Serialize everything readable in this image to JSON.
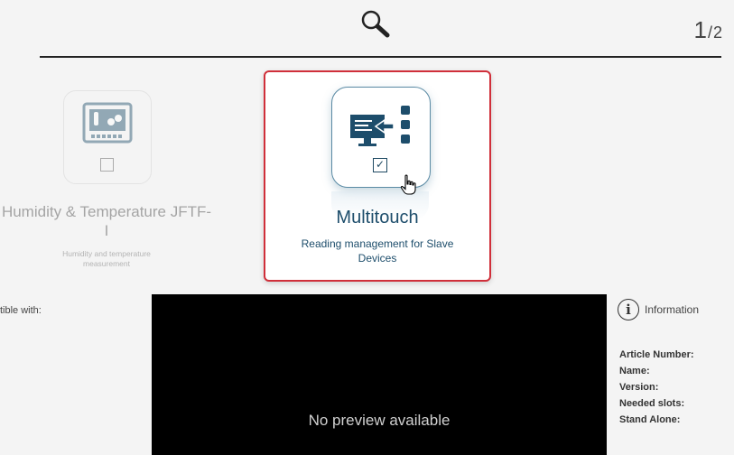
{
  "header": {
    "search_icon": "search-icon",
    "page_current": "1",
    "page_total": "2"
  },
  "cards": [
    {
      "title": "Humidity & Temperature JFTF-I",
      "description": "Humidity and temperature measurement",
      "icon": "humidity-temperature-icon",
      "checked": false
    },
    {
      "title": "Multitouch",
      "description": "Reading management for Slave Devices",
      "icon": "multitouch-icon",
      "checked": true,
      "highlight_color": "#d02f3a"
    }
  ],
  "compat_label": "tible with:",
  "preview": {
    "text": "No preview available"
  },
  "info": {
    "header": "Information",
    "rows": [
      "Article Number:",
      "Name:",
      "Version:",
      "Needed slots:",
      "Stand Alone:"
    ]
  },
  "colors": {
    "accent": "#1d4d6b",
    "highlight": "#d02f3a"
  }
}
